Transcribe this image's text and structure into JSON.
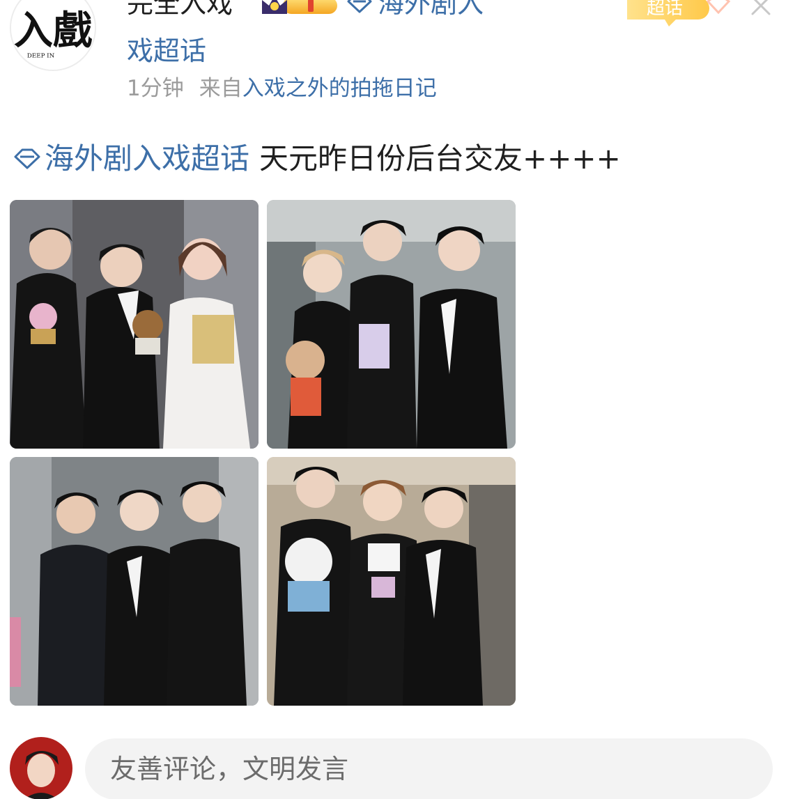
{
  "header": {
    "username": "完全入戏",
    "topic_line1": "海外剧入",
    "topic_line2": "戏超话",
    "time": "1分钟",
    "from_prefix": "来自",
    "from_source": "入戏之外的拍拖日记",
    "supertopic_badge": "超话",
    "logo_text_main": "入戲",
    "logo_text_sub": "DEEP IN"
  },
  "post": {
    "topic": "海外剧入戏超话",
    "content": "天元昨日份后台交友++++"
  },
  "photos": [
    {
      "name": "photo-1"
    },
    {
      "name": "photo-2"
    },
    {
      "name": "photo-3"
    },
    {
      "name": "photo-4"
    }
  ],
  "comment_bar": {
    "placeholder": "友善评论，文明发言"
  },
  "colors": {
    "link": "#3d6fa8",
    "text": "#1f1f1f",
    "muted": "#9b9b9b",
    "input_bg": "#f3f3f3",
    "badge_yellow": "#ffc94a"
  },
  "icons": [
    "diamond-topic-icon",
    "crown-level-icon",
    "close-icon",
    "supertopic-badge-icon"
  ]
}
